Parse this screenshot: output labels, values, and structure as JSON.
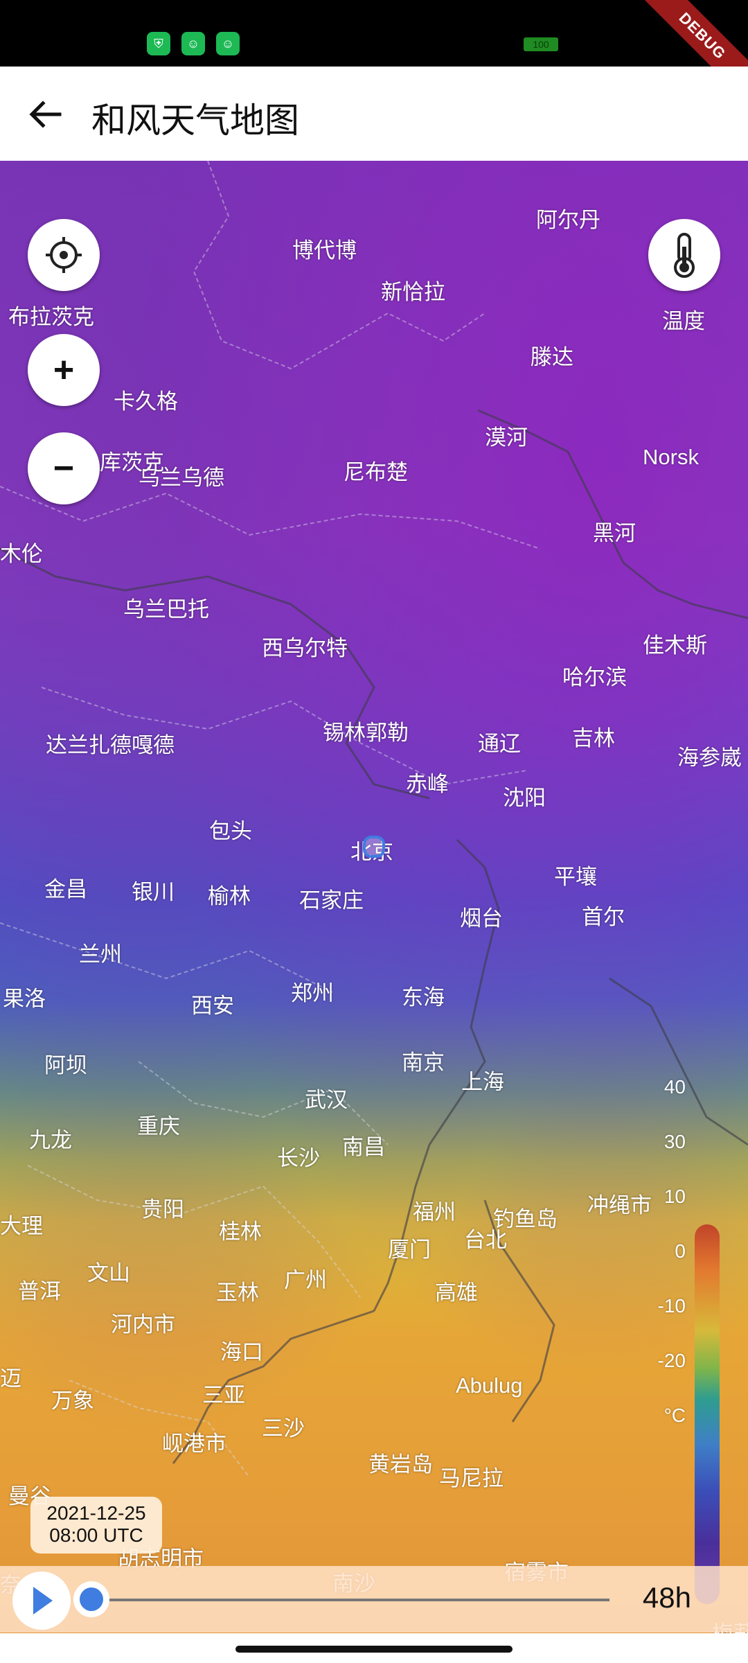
{
  "status_bar": {
    "battery": "100",
    "icons": [
      "shield-app-icon",
      "android-app-icon",
      "android-app-icon"
    ]
  },
  "debug_banner": "DEBUG",
  "app_bar": {
    "title": "和风天气地图"
  },
  "controls": {
    "locate_label": "布拉茨克",
    "zoom_in": "+",
    "zoom_out": "−",
    "layer_label": "温度"
  },
  "legend": {
    "ticks": [
      "40",
      "30",
      "10",
      "0",
      "-10",
      "-20",
      "°C"
    ],
    "colors": [
      "#c1442a",
      "#e2792f",
      "#d7b93a",
      "#7fb54a",
      "#2f9d8f",
      "#3f7fc7",
      "#3b4fb8",
      "#4a2f9b"
    ]
  },
  "map_labels": [
    "阿尔丹",
    "博代博",
    "新恰拉",
    "滕达",
    "卡久格",
    "乌兰乌德",
    "库茨克",
    "尼布楚",
    "漠河",
    "Norsk",
    "黑河",
    "木伦",
    "乌兰巴托",
    "西乌尔特",
    "佳木斯",
    "哈尔滨",
    "达兰扎德嘎德",
    "锡林郭勒",
    "通辽",
    "吉林",
    "海参崴",
    "赤峰",
    "沈阳",
    "包头",
    "北京",
    "平壤",
    "金昌",
    "银川",
    "榆林",
    "石家庄",
    "烟台",
    "首尔",
    "兰州",
    "果洛",
    "西安",
    "郑州",
    "东海",
    "阿坝",
    "南京",
    "上海",
    "武汉",
    "九龙",
    "重庆",
    "长沙",
    "南昌",
    "贵阳",
    "福州",
    "钓鱼岛",
    "冲绳市",
    "大理",
    "桂林",
    "厦门",
    "台北",
    "文山",
    "普洱",
    "广州",
    "玉林",
    "高雄",
    "河内市",
    "海口",
    "迈",
    "万象",
    "三亚",
    "Abulug",
    "三沙",
    "岘港市",
    "黄岩岛",
    "马尼拉",
    "曼谷",
    "胡志明市",
    "南沙",
    "宿雾市",
    "梅莉",
    "奈"
  ],
  "timeline": {
    "date": "2021-12-25",
    "time": "08:00 UTC",
    "hours": "48h",
    "progress": 0.0
  }
}
